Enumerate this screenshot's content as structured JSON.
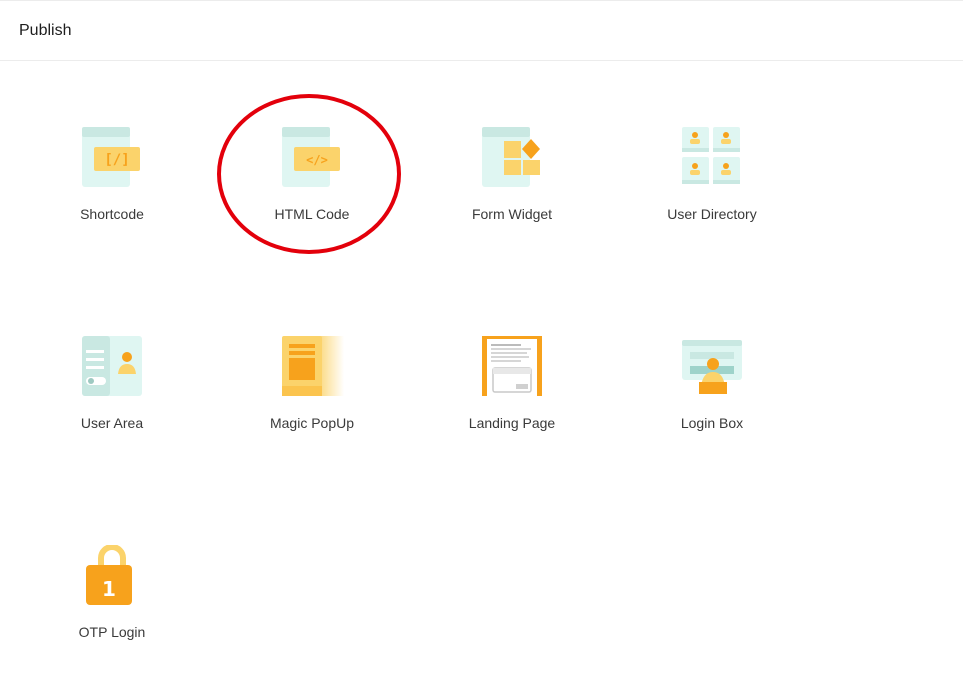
{
  "header": {
    "title": "Publish"
  },
  "tiles": [
    {
      "label": "Shortcode",
      "icon": "shortcode-icon",
      "glyph": "[/]"
    },
    {
      "label": "HTML Code",
      "icon": "html-code-icon",
      "glyph": "</>"
    },
    {
      "label": "Form Widget",
      "icon": "form-widget-icon"
    },
    {
      "label": "User Directory",
      "icon": "user-directory-icon"
    },
    {
      "label": "User Area",
      "icon": "user-area-icon"
    },
    {
      "label": "Magic PopUp",
      "icon": "magic-popup-icon"
    },
    {
      "label": "Landing Page",
      "icon": "landing-page-icon"
    },
    {
      "label": "Login Box",
      "icon": "login-box-icon"
    },
    {
      "label": "OTP Login",
      "icon": "otp-login-icon",
      "glyph": "1"
    }
  ],
  "colors": {
    "mint": "#dff6f2",
    "mint_dark": "#c9e8e2",
    "orange": "#f7a21c",
    "yellow": "#fbd36b",
    "annotation_red": "#e3000b"
  }
}
